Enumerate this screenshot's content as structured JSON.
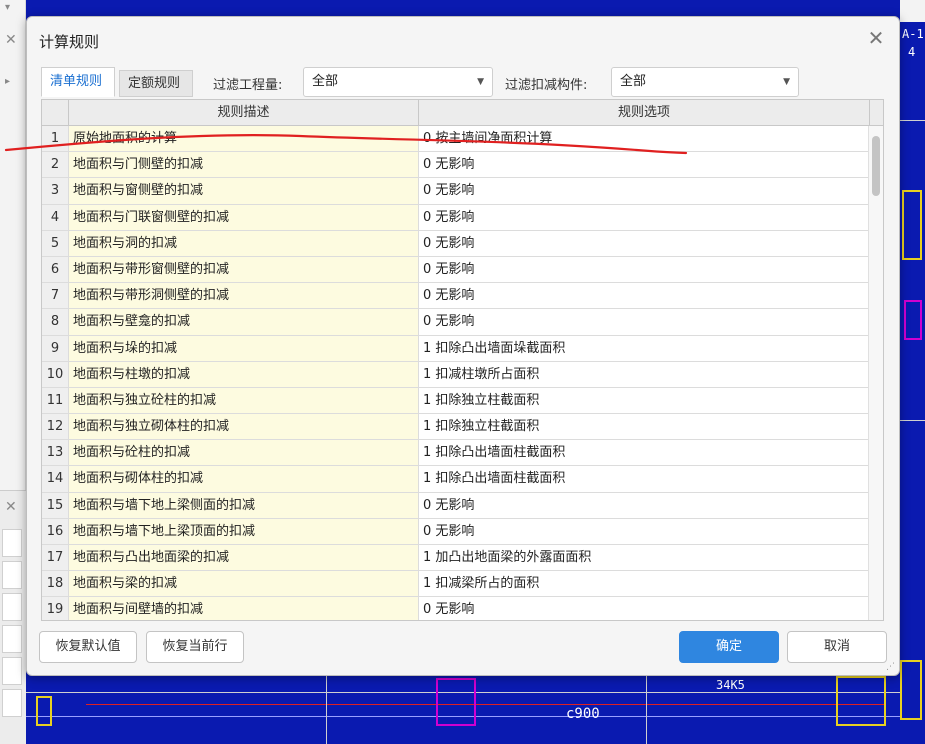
{
  "dialog": {
    "title": "计算规则",
    "tabs": [
      {
        "label": "清单规则",
        "active": true
      },
      {
        "label": "定额规则",
        "active": false
      }
    ],
    "filter_quantity": {
      "label": "过滤工程量:",
      "value": "全部"
    },
    "filter_component": {
      "label": "过滤扣减构件:",
      "value": "全部"
    },
    "table": {
      "headers": [
        "规则描述",
        "规则选项"
      ],
      "rows": [
        {
          "num": "1",
          "desc": "原始地面积的计算",
          "option": "0 按主墙间净面积计算"
        },
        {
          "num": "2",
          "desc": "地面积与门侧壁的扣减",
          "option": "0  无影响"
        },
        {
          "num": "3",
          "desc": "地面积与窗侧壁的扣减",
          "option": "0  无影响"
        },
        {
          "num": "4",
          "desc": "地面积与门联窗侧壁的扣减",
          "option": "0  无影响"
        },
        {
          "num": "5",
          "desc": "地面积与洞的扣减",
          "option": "0  无影响"
        },
        {
          "num": "6",
          "desc": "地面积与带形窗侧壁的扣减",
          "option": "0  无影响"
        },
        {
          "num": "7",
          "desc": "地面积与带形洞侧壁的扣减",
          "option": "0  无影响"
        },
        {
          "num": "8",
          "desc": "地面积与壁龛的扣减",
          "option": "0  无影响"
        },
        {
          "num": "9",
          "desc": "地面积与垛的扣减",
          "option": "1 扣除凸出墙面垛截面积"
        },
        {
          "num": "10",
          "desc": "地面积与柱墩的扣减",
          "option": "1 扣减柱墩所占面积"
        },
        {
          "num": "11",
          "desc": "地面积与独立砼柱的扣减",
          "option": "1 扣除独立柱截面积"
        },
        {
          "num": "12",
          "desc": "地面积与独立砌体柱的扣减",
          "option": "1 扣除独立柱截面积"
        },
        {
          "num": "13",
          "desc": "地面积与砼柱的扣减",
          "option": "1 扣除凸出墙面柱截面积"
        },
        {
          "num": "14",
          "desc": "地面积与砌体柱的扣减",
          "option": "1 扣除凸出墙面柱截面积"
        },
        {
          "num": "15",
          "desc": "地面积与墙下地上梁侧面的扣减",
          "option": "0  无影响"
        },
        {
          "num": "16",
          "desc": "地面积与墙下地上梁顶面的扣减",
          "option": "0  无影响"
        },
        {
          "num": "17",
          "desc": "地面积与凸出地面梁的扣减",
          "option": "1 加凸出地面梁的外露面面积"
        },
        {
          "num": "18",
          "desc": "地面积与梁的扣减",
          "option": "1 扣减梁所占的面积"
        },
        {
          "num": "19",
          "desc": "地面积与间壁墙的扣减",
          "option": "0  无影响"
        }
      ]
    },
    "buttons": {
      "restore_default": "恢复默认值",
      "restore_current": "恢复当前行",
      "ok": "确定",
      "cancel": "取消"
    }
  },
  "background": {
    "right_label": "A-1",
    "right_label2": "4",
    "cad_text": "c900",
    "cad_text2": "34K5"
  },
  "colors": {
    "accent": "#2f86e0",
    "cad_background": "#0a1ab0",
    "annotation": "#e02020",
    "desc_column": "#fdfbe0"
  }
}
